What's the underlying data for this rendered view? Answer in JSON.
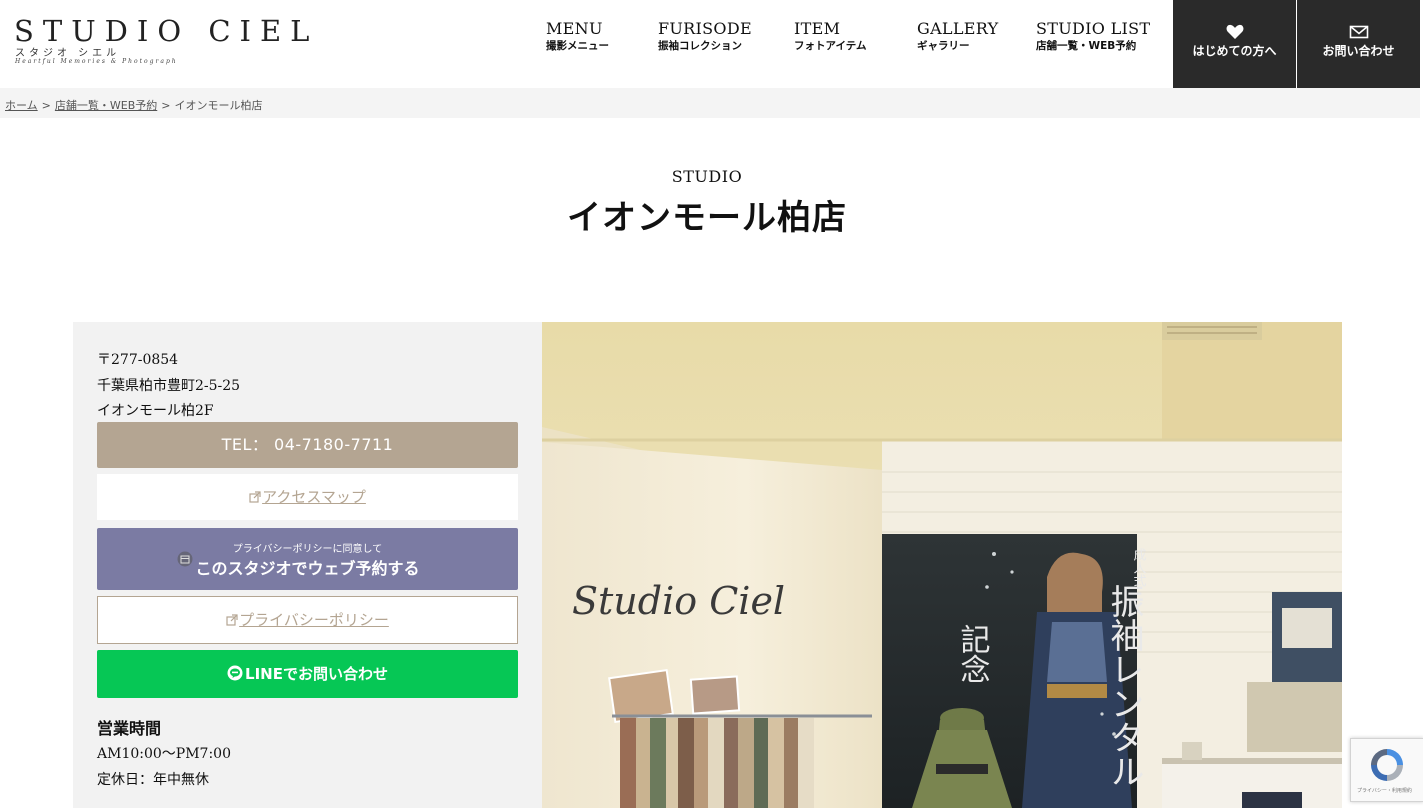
{
  "logo": {
    "main": "STUDIO CIEL",
    "kana": "スタジオ シエル",
    "tagline": "Heartful Memories & Photograph"
  },
  "nav": [
    {
      "en": "MENU",
      "ja": "撮影メニュー"
    },
    {
      "en": "FURISODE",
      "ja": "振袖コレクション"
    },
    {
      "en": "ITEM",
      "ja": "フォトアイテム"
    },
    {
      "en": "GALLERY",
      "ja": "ギャラリー"
    },
    {
      "en": "STUDIO LIST",
      "ja": "店舗一覧・WEB予約"
    }
  ],
  "header_buttons": {
    "first_time": {
      "label": "はじめての方へ",
      "icon": "heart-icon"
    },
    "contact": {
      "label": "お問い合わせ",
      "icon": "mail-icon"
    }
  },
  "breadcrumb": {
    "home": "ホーム",
    "studio_list": "店舗一覧・WEB予約",
    "separator": ">",
    "current": "イオンモール柏店"
  },
  "page": {
    "eyebrow": "STUDIO",
    "title": "イオンモール柏店"
  },
  "info": {
    "postal": "〒277-0854",
    "address1": "千葉県柏市豊町2-5-25",
    "address2": "イオンモール柏2F",
    "tel_label": "TEL： 04-7180-7711",
    "map_label": "アクセスマップ",
    "web_small": "プライバシーポリシーに同意して",
    "web_big": "このスタジオでウェブ予約する",
    "privacy_label": "プライバシーポリシー",
    "line_label": "LINEでお問い合わせ",
    "hours_heading": "営業時間",
    "hours": "AM10:00〜PM7:00",
    "closed": "定休日：年中無休"
  },
  "photo": {
    "wall_sign": "Studio Ciel",
    "poster_text": "振袖レンタル",
    "poster_small": "成人式",
    "poster_left": "記念"
  },
  "recaptcha": {
    "text": "プライバシー・利用規約"
  },
  "colors": {
    "header_dark": "#2a2a2a",
    "tan": "#b4a592",
    "purple": "#7b7ba3",
    "line_green": "#06c755",
    "panel_bg": "#f2f2f2"
  }
}
